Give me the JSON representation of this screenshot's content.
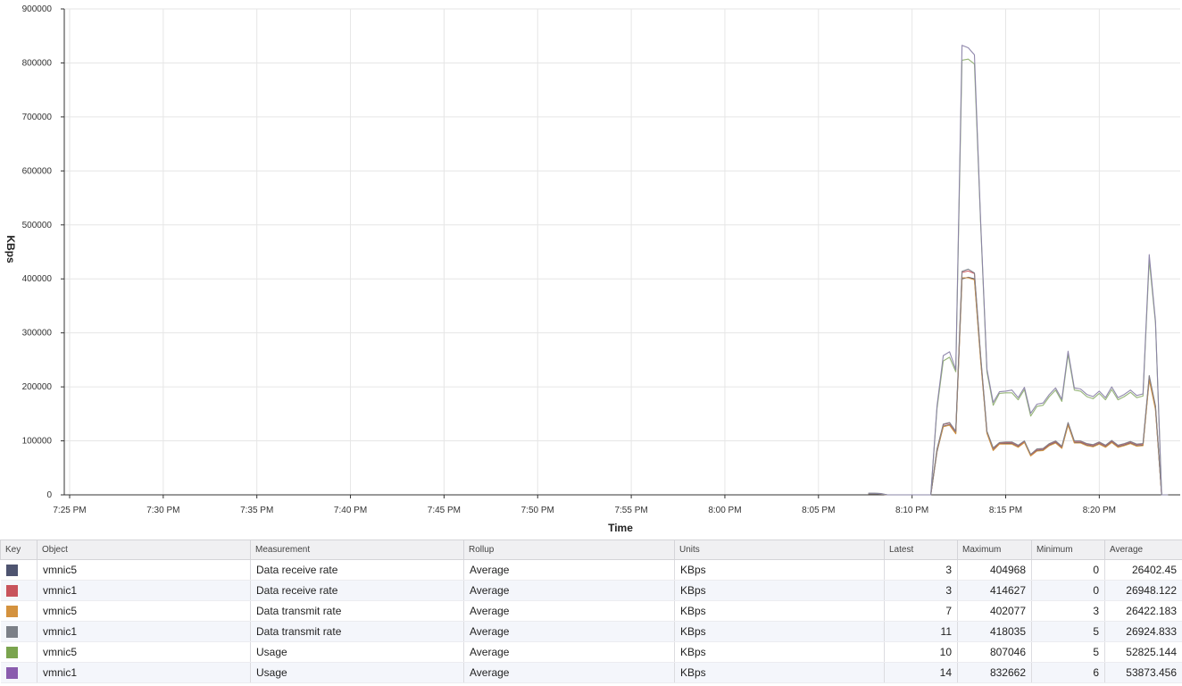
{
  "chart_data": {
    "type": "line",
    "xlabel": "Time",
    "ylabel": "KBps",
    "x_ticks": [
      "7:25 PM",
      "7:30 PM",
      "7:35 PM",
      "7:40 PM",
      "7:45 PM",
      "7:50 PM",
      "7:55 PM",
      "8:00 PM",
      "8:05 PM",
      "8:10 PM",
      "8:15 PM",
      "8:20 PM"
    ],
    "x_range": [
      "7:24 PM",
      "8:24 PM"
    ],
    "y_ticks": [
      0,
      100000,
      200000,
      300000,
      400000,
      500000,
      600000,
      700000,
      800000,
      900000
    ],
    "ylim": [
      0,
      900000
    ],
    "grid": true,
    "sample_interval_seconds": 20,
    "series_times": [
      "8:07:40 PM",
      "8:08:00 PM",
      "8:08:20 PM",
      "8:08:40 PM",
      "8:09:00 PM",
      "8:09:20 PM",
      "8:09:40 PM",
      "8:10:00 PM",
      "8:10:20 PM",
      "8:10:40 PM",
      "8:11:00 PM",
      "8:11:20 PM",
      "8:11:40 PM",
      "8:12:00 PM",
      "8:12:20 PM",
      "8:12:40 PM",
      "8:13:00 PM",
      "8:13:20 PM",
      "8:13:40 PM",
      "8:14:00 PM",
      "8:14:20 PM",
      "8:14:40 PM",
      "8:15:00 PM",
      "8:15:20 PM",
      "8:15:40 PM",
      "8:16:00 PM",
      "8:16:20 PM",
      "8:16:40 PM",
      "8:17:00 PM",
      "8:17:20 PM",
      "8:17:40 PM",
      "8:18:00 PM",
      "8:18:20 PM",
      "8:18:40 PM",
      "8:19:00 PM",
      "8:19:20 PM",
      "8:19:40 PM",
      "8:20:00 PM",
      "8:20:20 PM",
      "8:20:40 PM",
      "8:21:00 PM",
      "8:21:20 PM",
      "8:21:40 PM",
      "8:22:00 PM",
      "8:22:20 PM",
      "8:22:40 PM",
      "8:23:00 PM",
      "8:23:20 PM",
      "8:23:40 PM"
    ],
    "series": [
      {
        "name": "vmnic5 Data receive rate",
        "color": "#4e5470",
        "values": [
          2000,
          2000,
          1500,
          0,
          0,
          0,
          0,
          0,
          0,
          0,
          0,
          80000,
          127000,
          130000,
          114000,
          400000,
          403000,
          400000,
          250000,
          115000,
          83000,
          95000,
          95000,
          95000,
          89000,
          98000,
          73000,
          82000,
          83000,
          92000,
          97000,
          87000,
          130000,
          97000,
          97000,
          92000,
          90000,
          95000,
          89000,
          98000,
          89000,
          92000,
          96000,
          91000,
          92000,
          215000,
          160000,
          0,
          0
        ]
      },
      {
        "name": "vmnic1 Data receive rate",
        "color": "#c8545c",
        "values": [
          2000,
          2000,
          1500,
          0,
          0,
          0,
          0,
          0,
          0,
          0,
          0,
          84000,
          130000,
          133000,
          117000,
          412000,
          414627,
          410000,
          255000,
          117000,
          86000,
          96000,
          97000,
          97000,
          91000,
          99000,
          74000,
          84000,
          85000,
          94000,
          99000,
          89000,
          133000,
          99000,
          99000,
          94000,
          92000,
          97000,
          91000,
          100000,
          91000,
          94000,
          98000,
          93000,
          94000,
          219000,
          163000,
          0,
          0
        ]
      },
      {
        "name": "vmnic5 Data transmit rate",
        "color": "#d4923e",
        "values": [
          2000,
          2000,
          1500,
          0,
          0,
          0,
          0,
          0,
          0,
          0,
          0,
          82000,
          126000,
          129000,
          113000,
          402077,
          402000,
          398000,
          248000,
          114000,
          82000,
          94000,
          94000,
          94000,
          88000,
          97000,
          72000,
          81000,
          82000,
          91000,
          96000,
          86000,
          129000,
          96000,
          96000,
          91000,
          89000,
          94000,
          88000,
          97000,
          88000,
          91000,
          95000,
          90000,
          91000,
          213000,
          158000,
          0,
          0
        ]
      },
      {
        "name": "vmnic1 Data transmit rate",
        "color": "#7c8088",
        "values": [
          2000,
          2000,
          1500,
          0,
          0,
          0,
          0,
          0,
          0,
          0,
          0,
          85000,
          131000,
          134000,
          118000,
          414000,
          418035,
          411000,
          257000,
          118000,
          87000,
          97000,
          98000,
          98000,
          92000,
          100000,
          75000,
          85000,
          86000,
          95000,
          100000,
          90000,
          134000,
          100000,
          100000,
          95000,
          93000,
          98000,
          92000,
          101000,
          92000,
          95000,
          99000,
          94000,
          95000,
          221000,
          165000,
          0,
          0
        ]
      },
      {
        "name": "vmnic5 Usage",
        "color": "#8fb070",
        "values": [
          3000,
          3000,
          2500,
          0,
          0,
          0,
          0,
          0,
          0,
          0,
          0,
          160000,
          248000,
          255000,
          228000,
          805000,
          807046,
          798000,
          500000,
          228000,
          166000,
          188000,
          189000,
          189000,
          176000,
          195000,
          146000,
          164000,
          166000,
          182000,
          194000,
          173000,
          260000,
          194000,
          192000,
          182000,
          178000,
          188000,
          176000,
          195000,
          176000,
          182000,
          190000,
          180000,
          183000,
          435000,
          318000,
          0,
          0
        ]
      },
      {
        "name": "vmnic1 Usage",
        "color": "#8a82a8",
        "values": [
          3000,
          3000,
          2500,
          0,
          0,
          0,
          0,
          0,
          0,
          0,
          0,
          165000,
          258000,
          265000,
          232000,
          832662,
          828000,
          815000,
          505000,
          233000,
          171000,
          191000,
          192000,
          194000,
          180000,
          199000,
          151000,
          168000,
          170000,
          186000,
          198000,
          177000,
          266000,
          198000,
          196000,
          186000,
          182000,
          192000,
          180000,
          200000,
          180000,
          186000,
          194000,
          184000,
          187000,
          445000,
          322000,
          0,
          0
        ]
      }
    ]
  },
  "legend": {
    "headers": {
      "key": "Key",
      "object": "Object",
      "measurement": "Measurement",
      "rollup": "Rollup",
      "units": "Units",
      "latest": "Latest",
      "maximum": "Maximum",
      "minimum": "Minimum",
      "average": "Average"
    },
    "rows": [
      {
        "color": "#4e5470",
        "object": "vmnic5",
        "measurement": "Data receive rate",
        "rollup": "Average",
        "units": "KBps",
        "latest": "3",
        "maximum": "404968",
        "minimum": "0",
        "average": "26402.45"
      },
      {
        "color": "#c8545c",
        "object": "vmnic1",
        "measurement": "Data receive rate",
        "rollup": "Average",
        "units": "KBps",
        "latest": "3",
        "maximum": "414627",
        "minimum": "0",
        "average": "26948.122"
      },
      {
        "color": "#d4923e",
        "object": "vmnic5",
        "measurement": "Data transmit rate",
        "rollup": "Average",
        "units": "KBps",
        "latest": "7",
        "maximum": "402077",
        "minimum": "3",
        "average": "26422.183"
      },
      {
        "color": "#7c8088",
        "object": "vmnic1",
        "measurement": "Data transmit rate",
        "rollup": "Average",
        "units": "KBps",
        "latest": "11",
        "maximum": "418035",
        "minimum": "5",
        "average": "26924.833"
      },
      {
        "color": "#7aa44e",
        "object": "vmnic5",
        "measurement": "Usage",
        "rollup": "Average",
        "units": "KBps",
        "latest": "10",
        "maximum": "807046",
        "minimum": "5",
        "average": "52825.144"
      },
      {
        "color": "#8a5cae",
        "object": "vmnic1",
        "measurement": "Usage",
        "rollup": "Average",
        "units": "KBps",
        "latest": "14",
        "maximum": "832662",
        "minimum": "6",
        "average": "53873.456"
      }
    ]
  }
}
